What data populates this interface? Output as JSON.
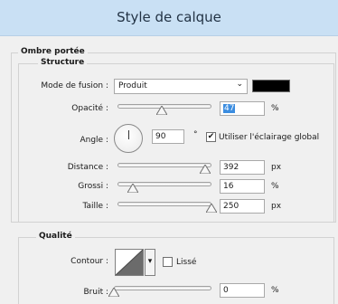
{
  "window": {
    "title": "Style de calque"
  },
  "drop_shadow": {
    "group_title": "Ombre portée",
    "structure_title": "Structure",
    "blend_mode": {
      "label": "Mode de fusion :",
      "value": "Produit",
      "color": "#000000"
    },
    "opacity": {
      "label": "Opacité :",
      "value": "47",
      "unit": "%",
      "fraction": 0.47
    },
    "angle": {
      "label": "Angle :",
      "value": "90",
      "unit": "°",
      "global_light_label": "Utiliser l'éclairage global",
      "global_light_checked": true
    },
    "distance": {
      "label": "Distance :",
      "value": "392",
      "unit": "px",
      "fraction": 0.93
    },
    "spread": {
      "label": "Grossi :",
      "value": "16",
      "unit": "%",
      "fraction": 0.16
    },
    "size": {
      "label": "Taille :",
      "value": "250",
      "unit": "px",
      "fraction": 1.0
    }
  },
  "quality": {
    "title": "Qualité",
    "contour": {
      "label": "Contour :",
      "smooth_label": "Lissé",
      "smooth_checked": false
    },
    "noise": {
      "label": "Bruit :",
      "value": "0",
      "unit": "%",
      "fraction": 0.0
    }
  },
  "icons": {
    "check": "✔",
    "dropdown": "⌄",
    "small_arrow": "▾",
    "degree": "°"
  }
}
